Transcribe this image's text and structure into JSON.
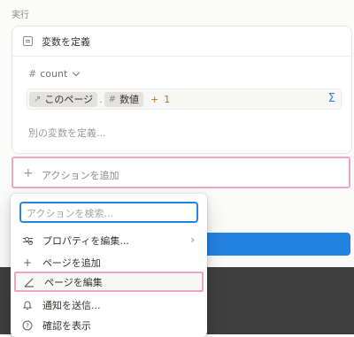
{
  "section": {
    "label": "実行"
  },
  "variable_card": {
    "title": "変数を定義",
    "variable_name": "count",
    "formula": {
      "token_page": "このページ",
      "separator": ".",
      "token_property": "数値",
      "operator": "+",
      "operand": "1"
    },
    "define_more": "別の変数を定義..."
  },
  "add_action": {
    "label": "アクションを追加"
  },
  "menu": {
    "search_placeholder": "アクションを検索...",
    "items": [
      {
        "label": "プロパティを編集...",
        "icon": "sliders-icon"
      },
      {
        "label": "ページを追加",
        "icon": "plus-icon"
      },
      {
        "label": "ページを編集",
        "icon": "edit-icon"
      },
      {
        "label": "通知を送信...",
        "icon": "bell-icon"
      },
      {
        "label": "確認を表示",
        "icon": "question-icon"
      }
    ]
  },
  "colors": {
    "accent": "#2383e2",
    "highlight": "#f1a5c2",
    "sigma": "#2f80ed"
  }
}
